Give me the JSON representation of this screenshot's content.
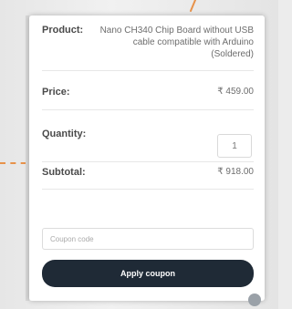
{
  "product": {
    "label": "Product:",
    "value": "Nano CH340 Chip Board without USB cable compatible with Arduino (Soldered)"
  },
  "price": {
    "label": "Price:",
    "value": "₹ 459.00"
  },
  "quantity": {
    "label": "Quantity:",
    "value": "1"
  },
  "subtotal": {
    "label": "Subtotal:",
    "value": "₹ 918.00"
  },
  "coupon": {
    "placeholder": "Coupon code",
    "button_label": "Apply coupon"
  },
  "colors": {
    "accent_orange": "#e7924a",
    "button_bg": "#1f2a36"
  }
}
